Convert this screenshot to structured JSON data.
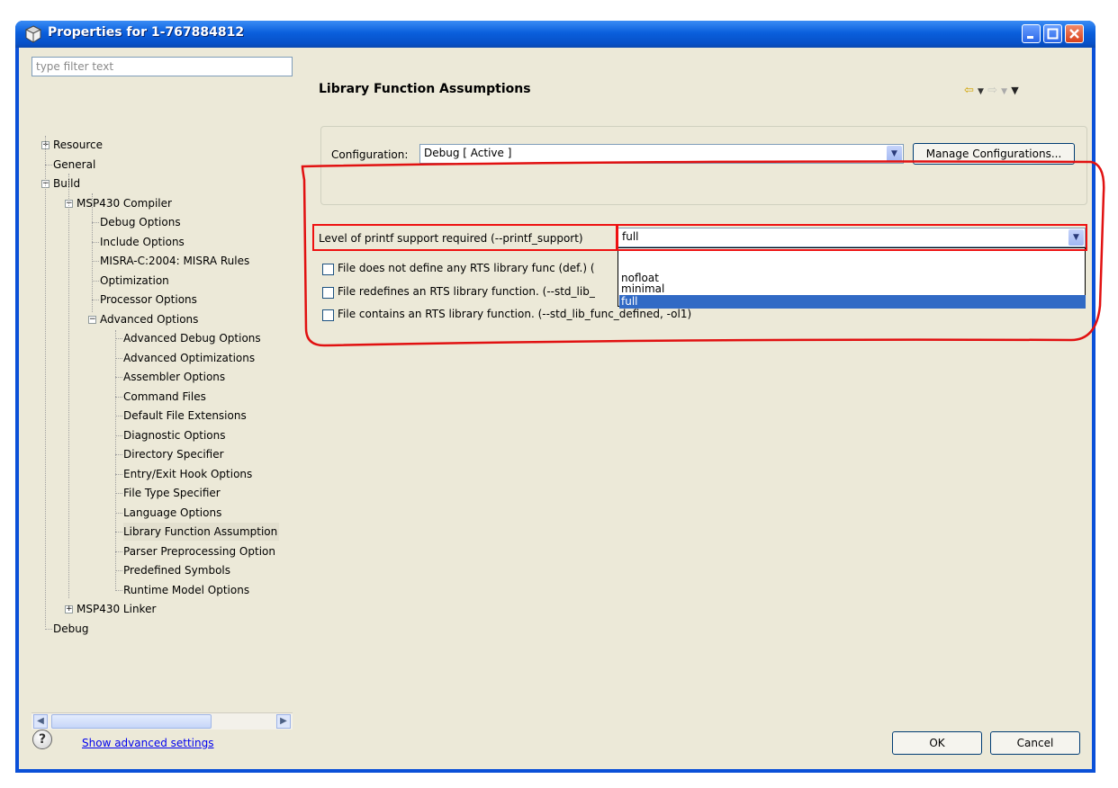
{
  "window": {
    "title": "Properties for 1-767884812",
    "controls": [
      "minimize-icon",
      "maximize-icon",
      "close-icon"
    ]
  },
  "filter": {
    "placeholder": "type filter text"
  },
  "tree": [
    {
      "label": "Resource",
      "expander": "+"
    },
    {
      "label": "General"
    },
    {
      "label": "Build",
      "expander": "-"
    },
    {
      "label": "MSP430 Compiler",
      "expander": "-"
    },
    {
      "label": "Debug Options"
    },
    {
      "label": "Include Options"
    },
    {
      "label": "MISRA-C:2004: MISRA Rules"
    },
    {
      "label": "Optimization"
    },
    {
      "label": "Processor Options"
    },
    {
      "label": "Advanced Options",
      "expander": "-"
    },
    {
      "label": "Advanced Debug Options"
    },
    {
      "label": "Advanced Optimizations"
    },
    {
      "label": "Assembler Options"
    },
    {
      "label": "Command Files"
    },
    {
      "label": "Default File Extensions"
    },
    {
      "label": "Diagnostic Options"
    },
    {
      "label": "Directory Specifier"
    },
    {
      "label": "Entry/Exit Hook Options"
    },
    {
      "label": "File Type Specifier"
    },
    {
      "label": "Language Options"
    },
    {
      "label": "Library Function Assumption",
      "selected": true
    },
    {
      "label": "Parser Preprocessing Option"
    },
    {
      "label": "Predefined Symbols"
    },
    {
      "label": "Runtime Model Options"
    },
    {
      "label": "MSP430 Linker",
      "expander": "+"
    },
    {
      "label": "Debug"
    }
  ],
  "page": {
    "title": "Library Function Assumptions",
    "nav": [
      "back-arrow-icon",
      "forward-arrow-icon",
      "view-menu-icon"
    ]
  },
  "configuration": {
    "label": "Configuration:",
    "value": "Debug  [ Active ]",
    "manage_button": "Manage Configurations..."
  },
  "printf": {
    "label": "Level of printf support required (--printf_support)",
    "value": "full",
    "options": [
      "nofloat",
      "minimal",
      "full"
    ],
    "selected_option": "full"
  },
  "checkboxes": [
    {
      "label": "File does not define any RTS library func (def.) (",
      "checked": false
    },
    {
      "label": "File redefines an RTS library function. (--std_lib_",
      "checked": false
    },
    {
      "label": "File contains an RTS library function. (--std_lib_func_defined, -ol1)",
      "checked": false
    }
  ],
  "footer": {
    "help_icon": "help-icon",
    "advanced_link": "Show advanced settings",
    "ok": "OK",
    "cancel": "Cancel"
  },
  "colors": {
    "title_bar": "#0a5fdc",
    "selection": "#316ac5",
    "annotation": "#e11111"
  }
}
